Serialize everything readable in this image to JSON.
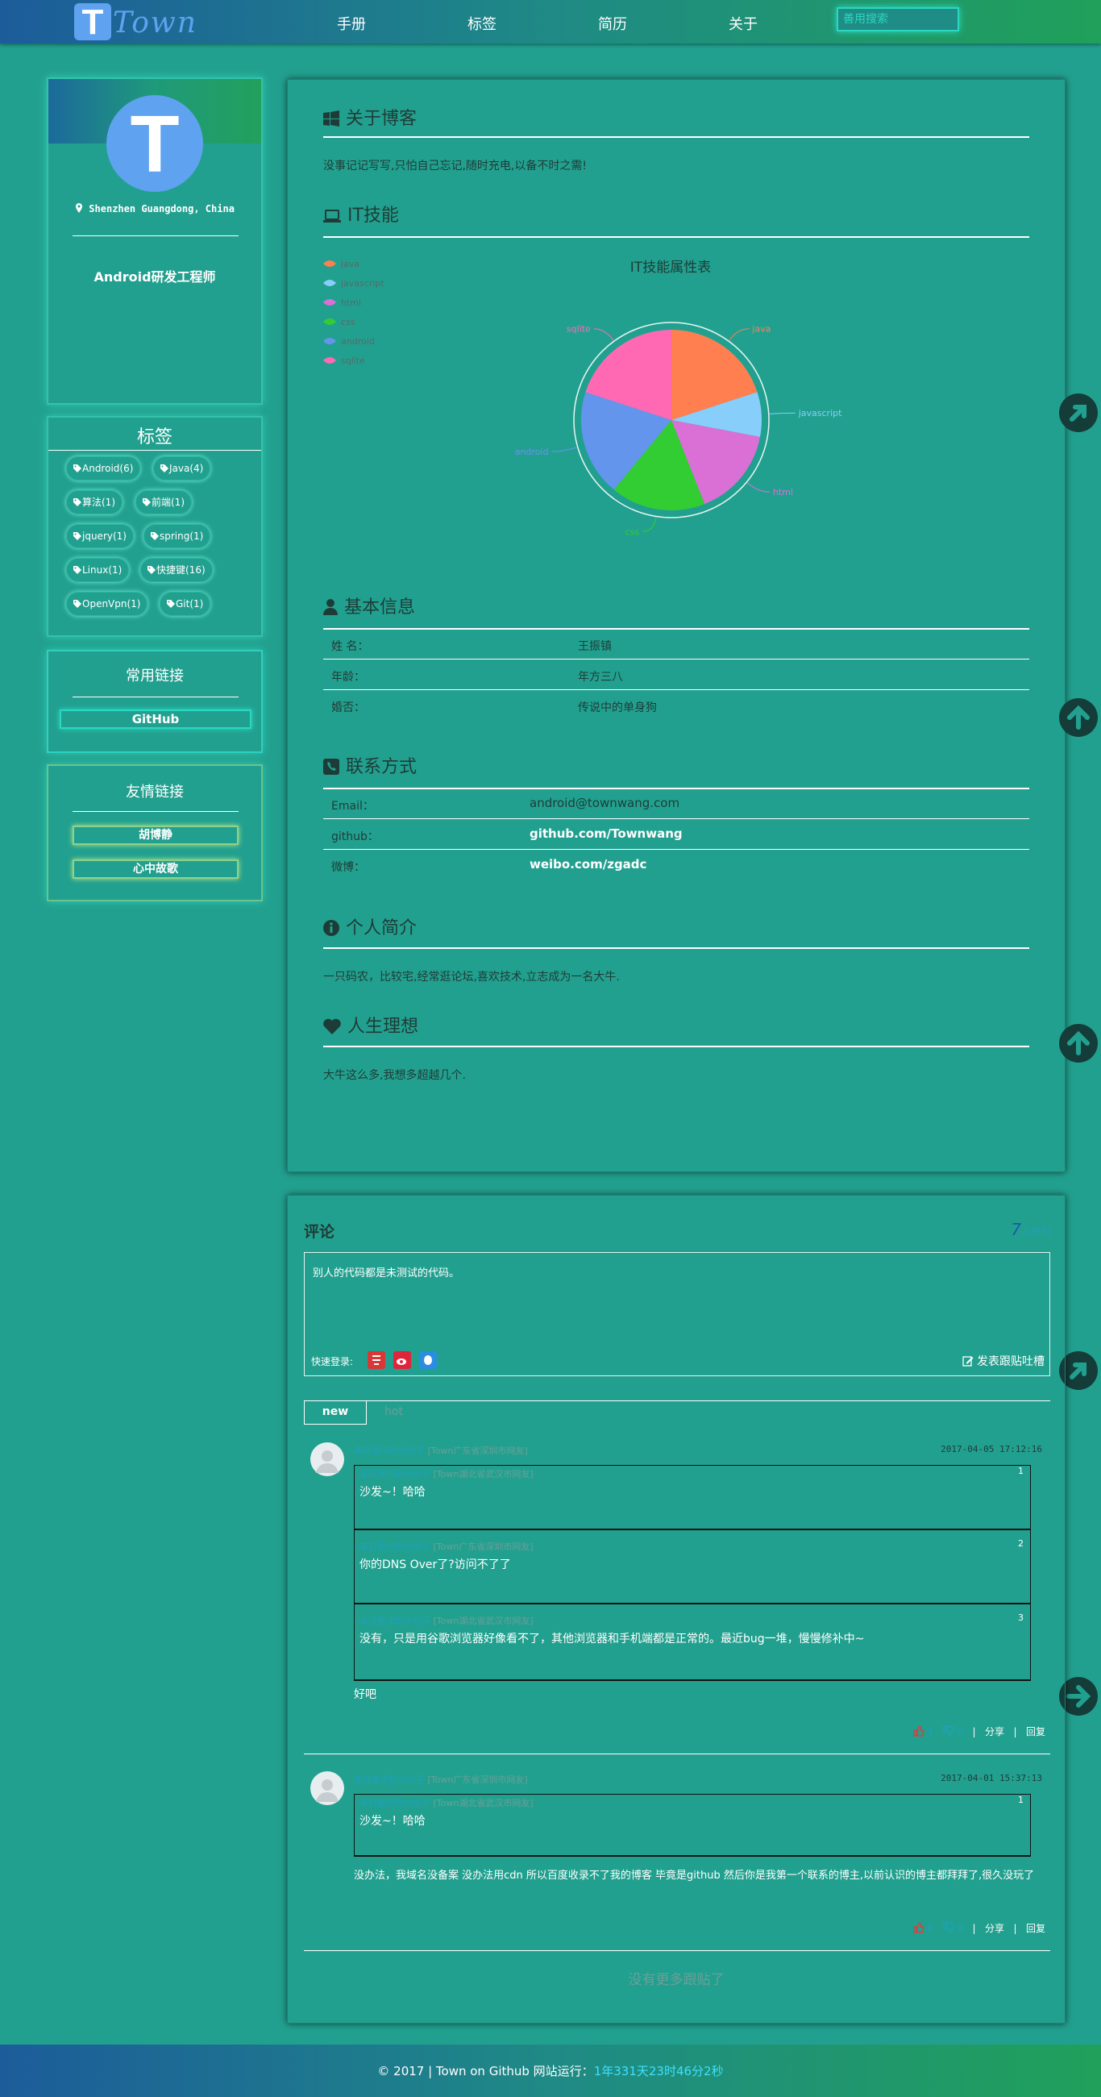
{
  "header": {
    "logo_letter": "T",
    "logo_text": "Town",
    "nav": [
      "手册",
      "标签",
      "简历",
      "关于"
    ],
    "search_placeholder": "善用搜索"
  },
  "profile": {
    "avatar_letter": "T",
    "location": "Shenzhen Guangdong, China",
    "job": "Android研发工程师"
  },
  "tags": {
    "title": "标签",
    "items": [
      "Android(6)",
      "Java(4)",
      "算法(1)",
      "前端(1)",
      "jquery(1)",
      "spring(1)",
      "Linux(1)",
      "快捷键(16)",
      "OpenVpn(1)",
      "Git(1)"
    ]
  },
  "common_links": {
    "title": "常用链接",
    "items": [
      "GitHub"
    ]
  },
  "friend_links": {
    "title": "友情链接",
    "items": [
      "胡博静",
      "心中故歌"
    ]
  },
  "about": {
    "title": "关于博客",
    "text": "没事记记写写,只怕自己忘记,随时充电,以备不时之需!"
  },
  "skills": {
    "title": "IT技能",
    "chart_title": "IT技能属性表"
  },
  "chart_data": {
    "type": "pie",
    "title": "IT技能属性表",
    "legend_position": "top-left",
    "slices": [
      {
        "label": "java",
        "value": 20,
        "color": "#ff7f50"
      },
      {
        "label": "javascript",
        "value": 8,
        "color": "#87cefa"
      },
      {
        "label": "html",
        "value": 16,
        "color": "#da70d6"
      },
      {
        "label": "css",
        "value": 17,
        "color": "#32cd32"
      },
      {
        "label": "android",
        "value": 19,
        "color": "#6495ed"
      },
      {
        "label": "sqlite",
        "value": 20,
        "color": "#ff69b4"
      }
    ]
  },
  "basic": {
    "title": "基本信息",
    "rows": [
      {
        "k": "姓 名：",
        "v": "王振镇"
      },
      {
        "k": "年龄：",
        "v": "年方三八"
      },
      {
        "k": "婚否：",
        "v": "传说中的单身狗"
      }
    ]
  },
  "contact": {
    "title": "联系方式",
    "rows": [
      {
        "k": "Email：",
        "v": "android@townwang.com"
      },
      {
        "k": "github：",
        "v": "github.com/Townwang"
      },
      {
        "k": "微博：",
        "v": "weibo.com/zgadc"
      }
    ]
  },
  "intro": {
    "title": "个人简介",
    "text": "一只码农，比较宅,经常逛论坛,喜欢技术,立志成为一名大牛."
  },
  "dream": {
    "title": "人生理想",
    "text": "大牛这么多,我想多超越几个."
  },
  "comments": {
    "title": "评论",
    "count": "7",
    "count_suffix": "人参与",
    "placeholder": "别人的代码都是未测试的代码。",
    "quick_login": "快速登录:",
    "post_label": "发表跟贴吐槽",
    "tab_new": "new",
    "tab_hot": "hot",
    "threads": [
      {
        "user": "来自重庆的小伙子",
        "loc": "[Town广东省深圳市网友]",
        "time": "2017-04-05 17:12:16",
        "quotes": [
          {
            "user": "来自重庆的小伙子",
            "loc": "[Town湖北省武汉市网友]",
            "num": "1",
            "text": "沙发~！哈哈"
          },
          {
            "user": "来自重庆的小伙子",
            "loc": "[Town广东省深圳市网友]",
            "num": "2",
            "text": "你的DNS Over了?访问不了了"
          },
          {
            "user": "来自重庆的小伙子",
            "loc": "[Town湖北省武汉市网友]",
            "num": "3",
            "text": "没有，只是用谷歌浏览器好像看不了，其他浏览器和手机端都是正常的。最近bug一堆，慢慢修补中~"
          }
        ],
        "reply": "好吧",
        "likes": "1",
        "dislikes": "0",
        "share": "分享",
        "reply_btn": "回复"
      },
      {
        "user": "来自重庆的小伙子",
        "loc": "[Town广东省深圳市网友]",
        "time": "2017-04-01 15:37:13",
        "quotes": [
          {
            "user": "来自重庆的小伙子",
            "loc": "[Town湖北省武汉市网友]",
            "num": "1",
            "text": "沙发~！哈哈"
          }
        ],
        "reply": "没办法，我域名没备案 没办法用cdn 所以百度收录不了我的博客 毕竟是github 然后你是我第一个联系的博主,以前认识的博主都拜拜了,很久没玩了",
        "likes": "0",
        "dislikes": "0",
        "share": "分享",
        "reply_btn": "回复"
      }
    ],
    "no_more": "没有更多跟贴了"
  },
  "footer": {
    "text": "© 2017 | Town on Github 网站运行：",
    "runtime": "1年331天23时46分2秒"
  }
}
